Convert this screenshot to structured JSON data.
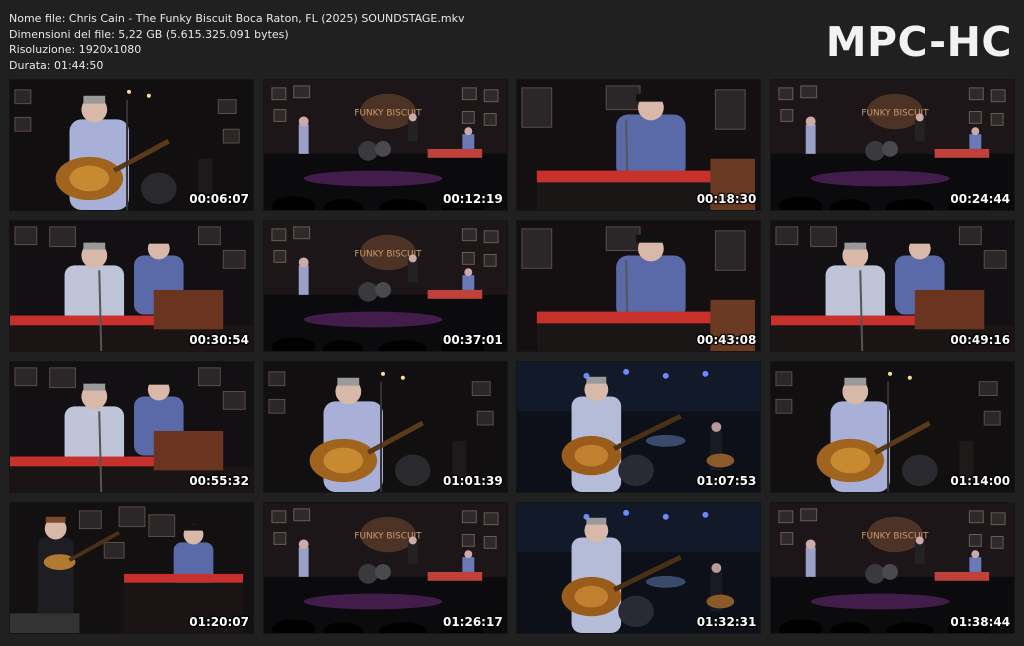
{
  "info": {
    "line1": "Nome file: Chris Cain - The Funky Biscuit Boca Raton, FL (2025) SOUNDSTAGE.mkv",
    "line2": "Dimensioni del file: 5,22 GB (5.615.325.091 bytes)",
    "line3": "Risoluzione: 1920x1080",
    "line4": "Durata: 01:44:50"
  },
  "logo": "MPC-HC",
  "thumbnails": [
    {
      "time": "00:06:07",
      "scene": "guitar-close"
    },
    {
      "time": "00:12:19",
      "scene": "wide-stage"
    },
    {
      "time": "00:18:30",
      "scene": "keys-player"
    },
    {
      "time": "00:24:44",
      "scene": "wide-stage"
    },
    {
      "time": "00:30:54",
      "scene": "keys-duo"
    },
    {
      "time": "00:37:01",
      "scene": "wide-stage"
    },
    {
      "time": "00:43:08",
      "scene": "keys-player"
    },
    {
      "time": "00:49:16",
      "scene": "keys-duo"
    },
    {
      "time": "00:55:32",
      "scene": "keys-duo"
    },
    {
      "time": "01:01:39",
      "scene": "guitar-close"
    },
    {
      "time": "01:07:53",
      "scene": "guitar-blue"
    },
    {
      "time": "01:14:00",
      "scene": "guitar-close"
    },
    {
      "time": "01:20:07",
      "scene": "bass-keys"
    },
    {
      "time": "01:26:17",
      "scene": "wide-stage"
    },
    {
      "time": "01:32:31",
      "scene": "guitar-blue"
    },
    {
      "time": "01:38:44",
      "scene": "wide-stage"
    }
  ]
}
